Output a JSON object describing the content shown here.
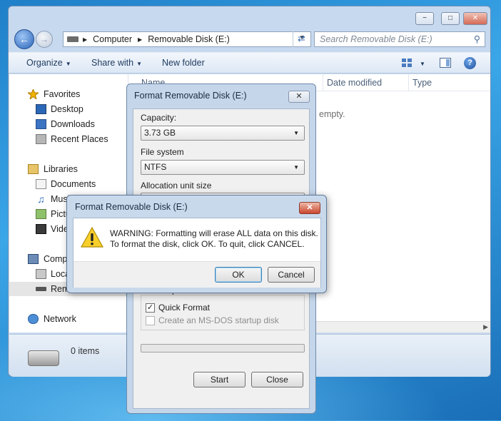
{
  "explorer": {
    "titlebar": {
      "minimize": "−",
      "maximize": "□",
      "close": "✕"
    },
    "address": {
      "crumbs": [
        "Computer",
        "Removable Disk (E:)"
      ]
    },
    "search": {
      "placeholder": "Search Removable Disk (E:)"
    },
    "toolbar": {
      "organize": "Organize",
      "share_with": "Share with",
      "new_folder": "New folder"
    },
    "columns": [
      "Name",
      "Date modified",
      "Type"
    ],
    "empty_message": "empty.",
    "nav": {
      "favorites": "Favorites",
      "desktop": "Desktop",
      "downloads": "Downloads",
      "recent_places": "Recent Places",
      "libraries": "Libraries",
      "documents": "Documents",
      "music": "Music",
      "pictures": "Pictu",
      "videos": "Vide",
      "computer": "Comp",
      "local_disk": "Loca",
      "removable": "Rem",
      "network": "Network"
    },
    "status": {
      "item_count": "0 items"
    }
  },
  "format_dialog": {
    "title": "Format Removable Disk (E:)",
    "close": "✕",
    "capacity_label": "Capacity:",
    "capacity_value": "3.73 GB",
    "file_system_label": "File system",
    "file_system_value": "NTFS",
    "allocation_label": "Allocation unit size",
    "format_options_label": "Format options",
    "quick_format": {
      "label": "Quick Format",
      "checked": true
    },
    "msdos_disk": {
      "label": "Create an MS-DOS startup disk",
      "checked": false,
      "enabled": false
    },
    "progress": 0,
    "start_button": "Start",
    "close_button": "Close"
  },
  "warning_dialog": {
    "title": "Format Removable Disk (E:)",
    "close": "✕",
    "line1": "WARNING: Formatting will erase ALL data on this disk.",
    "line2": "To format the disk, click OK. To quit, click CANCEL.",
    "ok_button": "OK",
    "cancel_button": "Cancel",
    "icon": "warning-icon"
  }
}
